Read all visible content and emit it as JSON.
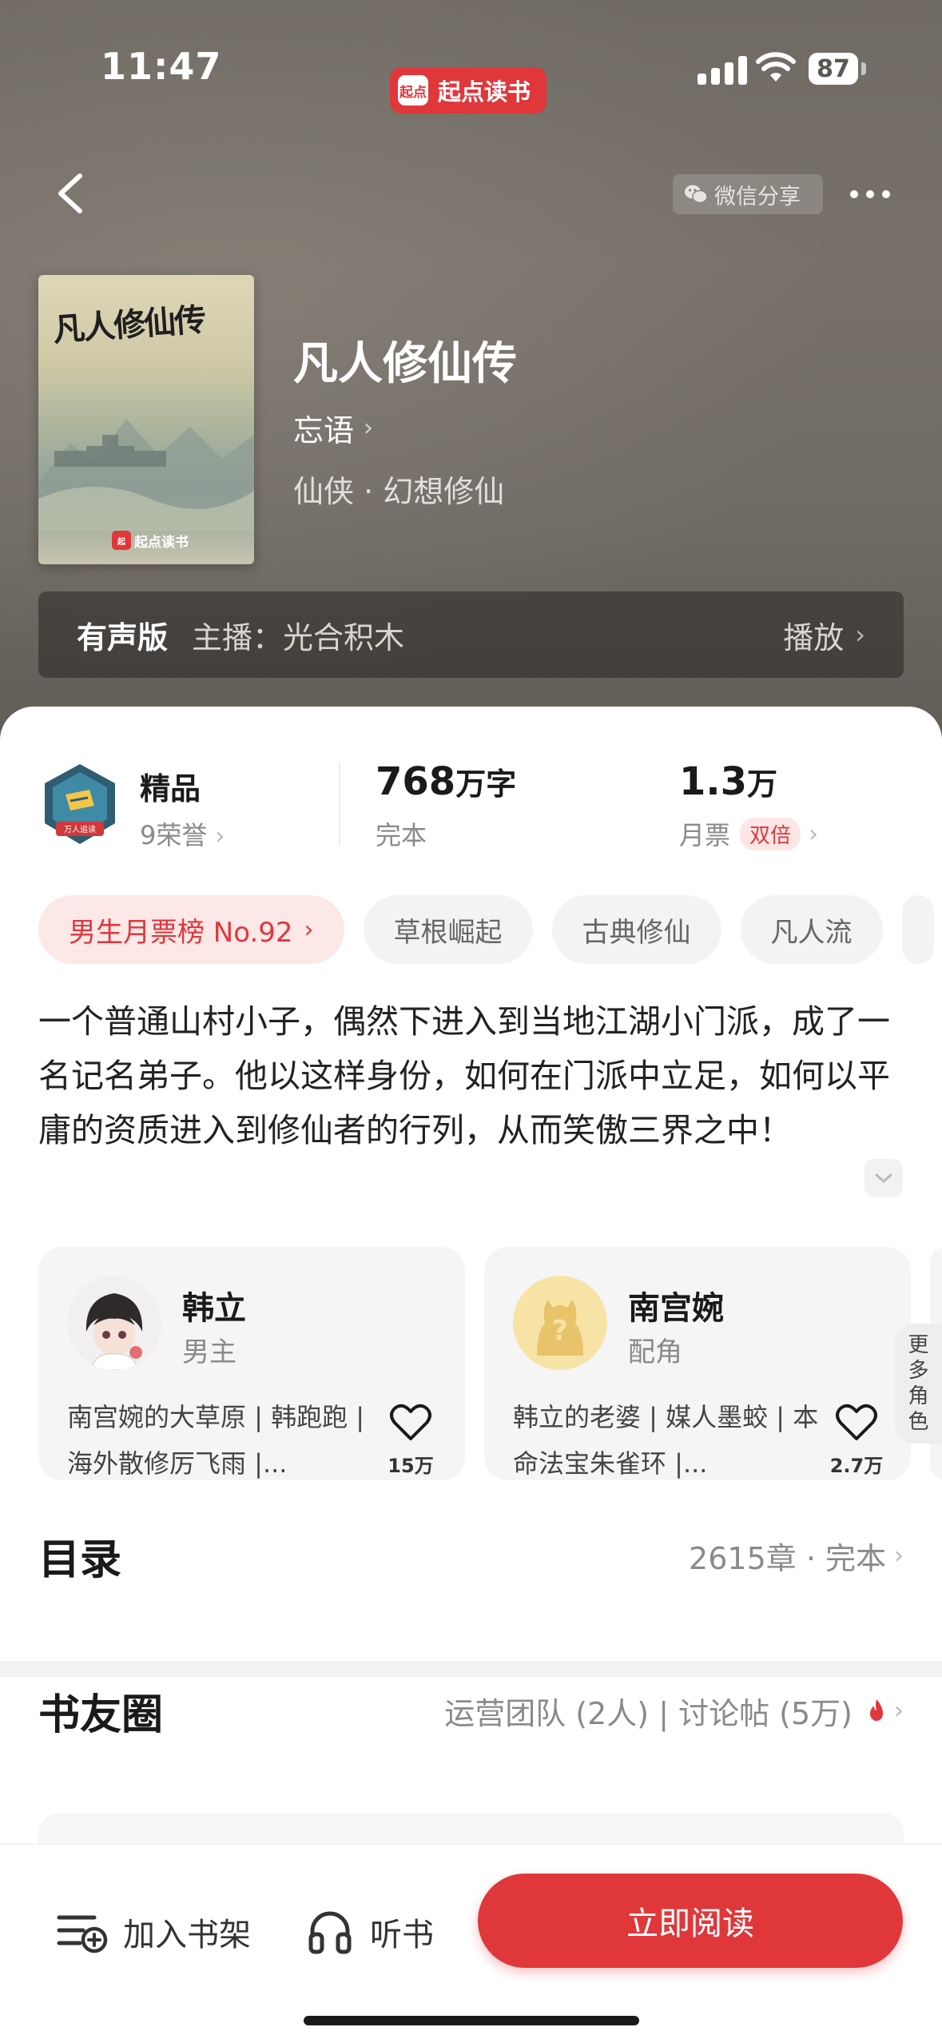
{
  "status_bar": {
    "time": "11:47",
    "app_name": "起点读书",
    "app_logo_text": "起点",
    "battery": "87"
  },
  "header": {
    "share_label": "微信分享"
  },
  "book": {
    "cover_title": "凡人修仙传",
    "cover_publisher": "起点读书",
    "title": "凡人修仙传",
    "author": "忘语",
    "genre": "仙侠 · 幻想修仙"
  },
  "audio": {
    "label": "有声版",
    "host": "主播：光合积木",
    "play_label": "播放"
  },
  "stats": {
    "quality_label": "精品",
    "honors": "9荣誉",
    "words_num": "768",
    "words_unit": "万字",
    "status": "完本",
    "tickets_num": "1.3",
    "tickets_unit": "万",
    "tickets_label": "月票",
    "double_label": "双倍"
  },
  "tags": [
    "男生月票榜 No.92",
    "草根崛起",
    "古典修仙",
    "凡人流"
  ],
  "intro": "一个普通山村小子，偶然下进入到当地江湖小门派，成了一名记名弟子。他以这样身份，如何在门派中立足，如何以平庸的资质进入到修仙者的行列，从而笑傲三界之中！",
  "roles": [
    {
      "name": "韩立",
      "type": "男主",
      "desc": "南宫婉的大草原 | 韩跑跑 | 海外散修厉飞雨 |...",
      "likes": "15万"
    },
    {
      "name": "南宫婉",
      "type": "配角",
      "desc": "韩立的老婆 | 媒人墨蛟 | 本命法宝朱雀环 |...",
      "likes": "2.7万"
    }
  ],
  "more_roles": [
    "更",
    "多",
    "角",
    "色"
  ],
  "toc": {
    "title": "目录",
    "meta": "2615章 · 完本"
  },
  "circle": {
    "title": "书友圈",
    "meta": "运营团队 (2人) | 讨论帖 (5万)"
  },
  "bottom": {
    "add_shelf": "加入书架",
    "listen": "听书",
    "read": "立即阅读"
  },
  "colors": {
    "accent": "#e0373b",
    "hero_bg": "#6f6a63"
  }
}
